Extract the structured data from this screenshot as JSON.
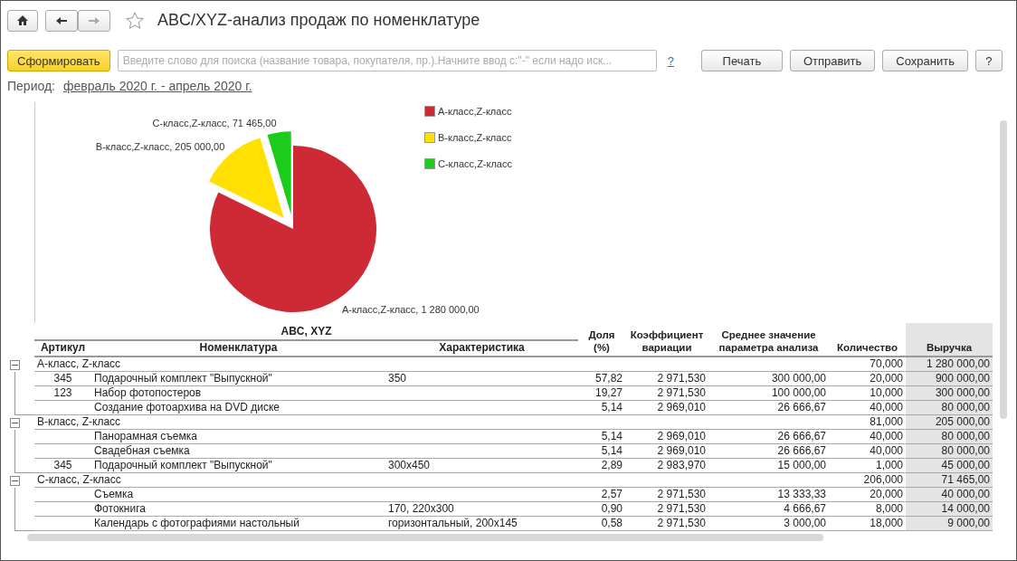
{
  "nav": {
    "back": true,
    "forward": false,
    "favorite": false
  },
  "window": {
    "title": "ABC/XYZ-анализ продаж по номенклатуре"
  },
  "command_bar": {
    "generate_button": "Сформировать",
    "search": {
      "placeholder": "Введите слово для поиска (название товара, покупателя, пр.).Начните ввод с:\"-\" если надо иск..."
    },
    "search_help": "?",
    "buttons": [
      "Печать",
      "Отправить",
      "Сохранить",
      "?"
    ]
  },
  "period": {
    "label": "Период:",
    "value": "февраль 2020 г. - апрель 2020 г."
  },
  "chart": {
    "chart_data": {
      "type": "pie",
      "categories": [
        "А-класс,Z-класс",
        "В-класс,Z-класс",
        "С-класс,Z-класс"
      ],
      "values": [
        1280000,
        205000,
        71465
      ],
      "colors": [
        "#cd2a36",
        "#ffe000",
        "#1ccc1c"
      ],
      "value_labels": [
        "А-класс,Z-класс, 1 280 000,00",
        "В-класс,Z-класс, 205 000,00",
        "С-класс,Z-класс, 71 465,00"
      ]
    }
  },
  "table": {
    "group_header": "ABC, XYZ",
    "columns": [
      "Артикул",
      "Номенклатура",
      "Характеристика",
      "Доля (%)",
      "Коэффициент вариации",
      "Среднее значение параметра анализа",
      "Количество",
      "Выручка"
    ],
    "groups": [
      {
        "label": "А-класс, Z-класс",
        "expanded": true,
        "quantity": "70,000",
        "revenue": "1 280 000,00",
        "rows": [
          {
            "article": "345",
            "item": "Подарочный комплект \"Выпускной\"",
            "characteristic": "350",
            "share": "57,82",
            "variation": "2 971,530",
            "average": "300 000,00",
            "quantity": "20,000",
            "revenue": "900 000,00"
          },
          {
            "article": "123",
            "item": "Набор фотопостеров",
            "characteristic": "",
            "share": "19,27",
            "variation": "2 971,530",
            "average": "100 000,00",
            "quantity": "10,000",
            "revenue": "300 000,00"
          },
          {
            "article": "",
            "item": "Создание фотоархива на DVD диске",
            "characteristic": "",
            "share": "5,14",
            "variation": "2 969,010",
            "average": "26 666,67",
            "quantity": "40,000",
            "revenue": "80 000,00"
          }
        ]
      },
      {
        "label": "В-класс, Z-класс",
        "expanded": true,
        "quantity": "81,000",
        "revenue": "205 000,00",
        "rows": [
          {
            "article": "",
            "item": "Панорамная съемка",
            "characteristic": "",
            "share": "5,14",
            "variation": "2 969,010",
            "average": "26 666,67",
            "quantity": "40,000",
            "revenue": "80 000,00"
          },
          {
            "article": "",
            "item": "Свадебная съемка",
            "characteristic": "",
            "share": "5,14",
            "variation": "2 969,010",
            "average": "26 666,67",
            "quantity": "40,000",
            "revenue": "80 000,00"
          },
          {
            "article": "345",
            "item": "Подарочный комплект \"Выпускной\"",
            "characteristic": "300x450",
            "share": "2,89",
            "variation": "2 983,970",
            "average": "15 000,00",
            "quantity": "1,000",
            "revenue": "45 000,00"
          }
        ]
      },
      {
        "label": "С-класс, Z-класс",
        "expanded": true,
        "quantity": "206,000",
        "revenue": "71 465,00",
        "rows": [
          {
            "article": "",
            "item": "Съемка",
            "characteristic": "",
            "share": "2,57",
            "variation": "2 971,530",
            "average": "13 333,33",
            "quantity": "20,000",
            "revenue": "40 000,00"
          },
          {
            "article": "",
            "item": "Фотокнига",
            "characteristic": "170, 220x300",
            "share": "0,90",
            "variation": "2 971,530",
            "average": "4 666,67",
            "quantity": "8,000",
            "revenue": "14 000,00"
          },
          {
            "article": "",
            "item": "Календарь с фотографиями настольный",
            "characteristic": "горизонтальный, 200x145",
            "share": "0,58",
            "variation": "2 971,530",
            "average": "3 000,00",
            "quantity": "18,000",
            "revenue": "9 000,00"
          }
        ]
      }
    ]
  }
}
